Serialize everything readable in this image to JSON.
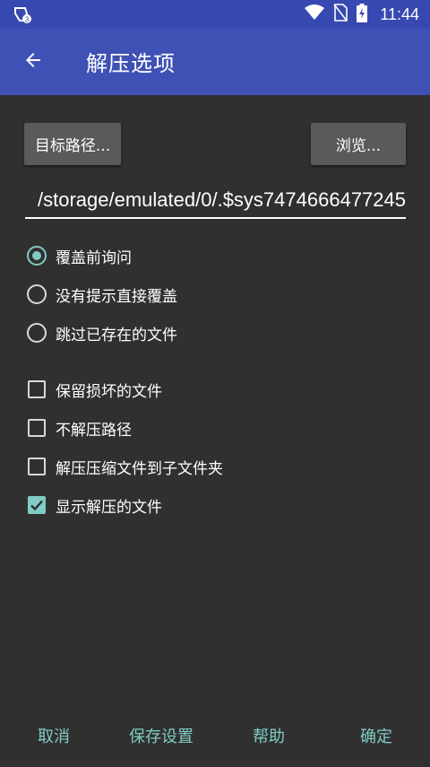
{
  "statusbar": {
    "time": "11:44",
    "icons": [
      "shield-notification-icon",
      "wifi-icon",
      "no-sim-icon",
      "battery-charging-icon"
    ]
  },
  "appbar": {
    "title": "解压选项",
    "back_icon": "arrow-left-icon"
  },
  "actions": {
    "target_path_label": "目标路径...",
    "browse_label": "浏览..."
  },
  "path": {
    "value": "/storage/emulated/0/.$sys7474666477245"
  },
  "overwrite_options": [
    {
      "label": "覆盖前询问",
      "checked": true
    },
    {
      "label": "没有提示直接覆盖",
      "checked": false
    },
    {
      "label": "跳过已存在的文件",
      "checked": false
    }
  ],
  "checkbox_options": [
    {
      "label": "保留损坏的文件",
      "checked": false
    },
    {
      "label": "不解压路径",
      "checked": false
    },
    {
      "label": "解压压缩文件到子文件夹",
      "checked": false
    },
    {
      "label": "显示解压的文件",
      "checked": true
    }
  ],
  "footer": {
    "cancel": "取消",
    "save_settings": "保存设置",
    "help": "帮助",
    "ok": "确定"
  },
  "colors": {
    "statusbar": "#3748b0",
    "appbar": "#3f51b5",
    "background": "#303030",
    "accent": "#80cbc4",
    "button": "#5a5a5a"
  }
}
